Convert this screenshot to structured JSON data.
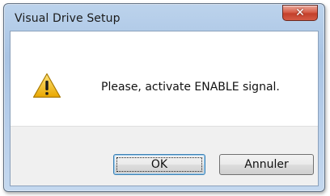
{
  "window": {
    "title": "Visual Drive Setup"
  },
  "titlebar": {
    "close_icon": "close-icon"
  },
  "message": {
    "icon": "warning-icon",
    "text": "Please, activate ENABLE signal."
  },
  "buttons": {
    "ok_label": "OK",
    "cancel_label": "Annuler"
  },
  "colors": {
    "titlebar": "#b5cdea",
    "close_button": "#c94a36",
    "warning_fill": "#f5c518",
    "footer": "#f0f0f0"
  }
}
